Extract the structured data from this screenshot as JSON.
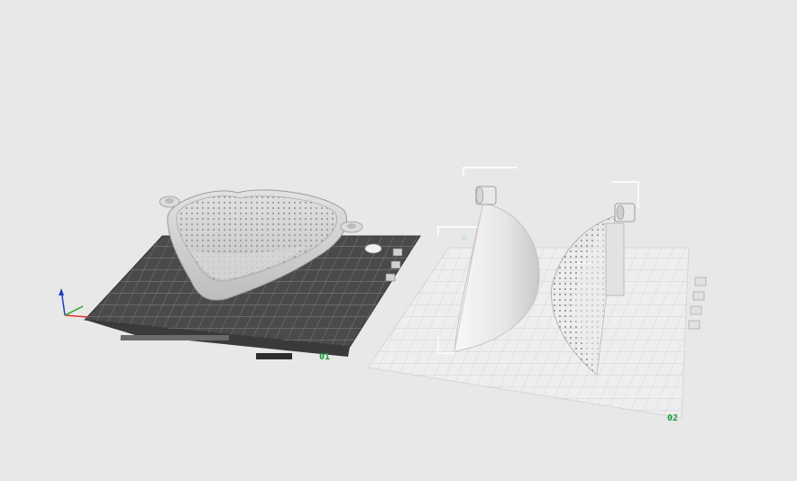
{
  "viewport": {
    "background": "#e8e8e8",
    "plates": [
      {
        "label": "01",
        "state": "selected",
        "bed_color": "#4a4a4a",
        "grid_color": "#8a8a8a",
        "objects": [
          "heart-bowl-model"
        ],
        "controls": [
          "close-icon",
          "arrange-icon",
          "settings-icon"
        ]
      },
      {
        "label": "02",
        "state": "inactive",
        "bed_color": "#eeeeee",
        "grid_color": "#cfcfcf",
        "objects": [
          "heart-half-left-model",
          "heart-half-right-model"
        ],
        "controls": [
          "close-icon",
          "arrange-icon",
          "slice-icon",
          "settings-icon"
        ]
      }
    ],
    "axis_colors": {
      "x": "#e03030",
      "y": "#2aa02a",
      "z": "#2040c0"
    },
    "accent": "#1a9a3a"
  }
}
